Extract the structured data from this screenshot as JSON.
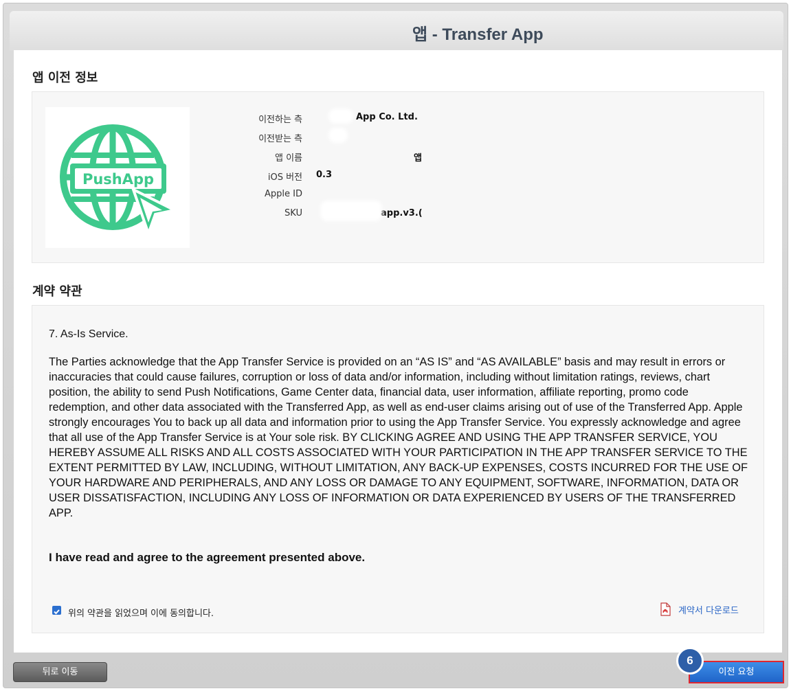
{
  "title": "앱 - Transfer App",
  "app_info": {
    "heading": "앱 이전 정보",
    "logo_text": "PushApp",
    "rows": [
      {
        "label": "이전하는 측",
        "value": "App Co. Ltd."
      },
      {
        "label": "이전받는 측",
        "value": ""
      },
      {
        "label": "앱 이름",
        "value": "앱"
      },
      {
        "label": "iOS 버전",
        "value": "0.3"
      },
      {
        "label": "Apple ID",
        "value": ""
      },
      {
        "label": "SKU",
        "value": "app.v3.("
      }
    ]
  },
  "terms": {
    "heading": "계약 약관",
    "section_title": "7. As-Is Service.",
    "body": "The Parties acknowledge that the App Transfer Service is provided on an “AS IS” and “AS AVAILABLE” basis and may result in errors or inaccuracies that could cause failures, corruption or loss of data and/or information, including without limitation ratings, reviews, chart position, the ability to send Push Notifications, Game Center data, financial data, user information, affiliate reporting, promo code redemption, and other data associated with the Transferred App, as well as end-user claims arising out of use of the Transferred App. Apple strongly encourages You to back up all data and information prior to using the App Transfer Service. You expressly acknowledge and agree that all use of the App Transfer Service is at Your sole risk. BY CLICKING AGREE AND USING THE APP TRANSFER SERVICE, YOU HEREBY ASSUME ALL RISKS AND ALL COSTS ASSOCIATED WITH YOUR PARTICIPATION IN THE APP TRANSFER SERVICE TO THE EXTENT PERMITTED BY LAW, INCLUDING, WITHOUT LIMITATION, ANY BACK-UP EXPENSES, COSTS INCURRED FOR THE USE OF YOUR HARDWARE AND PERIPHERALS, AND ANY LOSS OR DAMAGE TO ANY EQUIPMENT, SOFTWARE, INFORMATION, DATA OR USER DISSATISFACTION, INCLUDING ANY LOSS OF INFORMATION OR DATA EXPERIENCED BY USERS OF THE TRANSFERRED APP.",
    "agree_statement": "I have read and agree to the agreement presented above.",
    "checkbox_label": "위의 약관을 읽었으며 이에 동의합니다.",
    "checkbox_checked": true,
    "download_label": "계약서 다운로드"
  },
  "buttons": {
    "back": "뒤로 이동",
    "transfer": "이전 요청"
  },
  "step_badge": "6",
  "colors": {
    "logo_green": "#3ec98c",
    "accent_blue": "#1f64c8",
    "highlight_red": "#e0262f"
  }
}
